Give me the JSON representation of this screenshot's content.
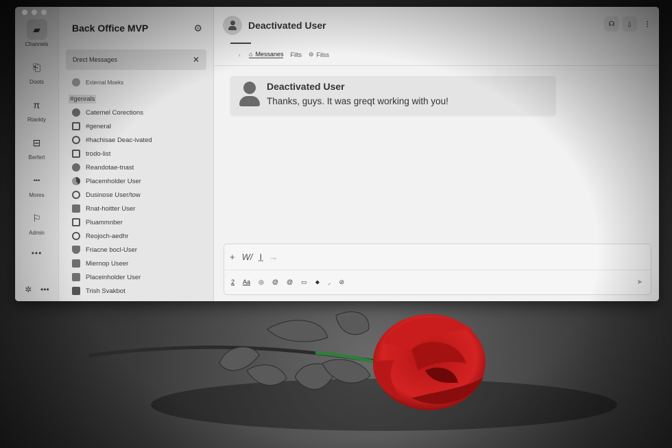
{
  "app": {
    "workspace_title": "Back Office MVP"
  },
  "rail": {
    "items": [
      {
        "label": "Channels",
        "icon": "briefcase-icon",
        "glyph": "▰"
      },
      {
        "label": "Doots",
        "icon": "doc-icon",
        "glyph": "⎗"
      },
      {
        "label": "Rtankty",
        "icon": "pi-icon",
        "glyph": "π"
      },
      {
        "label": "Berfert",
        "icon": "inbox-icon",
        "glyph": "⊟"
      },
      {
        "label": "Mores",
        "icon": "more-icon",
        "glyph": "•••"
      },
      {
        "label": "Admin",
        "icon": "bookmark-icon",
        "glyph": "⚐"
      }
    ],
    "bottom": [
      "✲",
      "•••"
    ]
  },
  "sidebar": {
    "dm_tab_label": "Drect Messages",
    "items": [
      {
        "label": "External Moeks",
        "small": true
      },
      {
        "label": "#genrals",
        "highlight": true
      },
      {
        "label": "Caternel Corections"
      },
      {
        "label": "#general"
      },
      {
        "label": "#hachisae Deac-ivated"
      },
      {
        "label": "trodo-list"
      },
      {
        "label": "Reandotae-tnast"
      },
      {
        "label": "Placemholder User"
      },
      {
        "label": "Dusinose User/tow"
      },
      {
        "label": "Rnat-hoitter User"
      },
      {
        "label": "Piuammnber"
      },
      {
        "label": "Reojoch-aedhr"
      },
      {
        "label": "Friacne bocl-User"
      },
      {
        "label": "Miernop Useer"
      },
      {
        "label": "Placeinholder User"
      },
      {
        "label": "Trish Svakbot"
      }
    ]
  },
  "main": {
    "channel_title": "Deactivated User",
    "tabs": [
      {
        "label": "Messanes",
        "icon": "⌂",
        "active": true
      },
      {
        "label": "Filts",
        "icon": "",
        "active": false
      },
      {
        "label": "Filss",
        "icon": "⊜",
        "active": false
      }
    ],
    "header_actions": [
      "☊",
      "⍙",
      "⋮"
    ]
  },
  "message": {
    "author": "Deactivated User",
    "text": "Thanks, guys. It was greqt working with you!"
  },
  "composer": {
    "row1": [
      "+",
      "W/",
      "I̲",
      "→"
    ],
    "row2": [
      "2",
      "Aa",
      "◎",
      "@",
      "@",
      "▭",
      "⬥",
      "⸝",
      "⊘"
    ],
    "send_glyph": "➤"
  }
}
